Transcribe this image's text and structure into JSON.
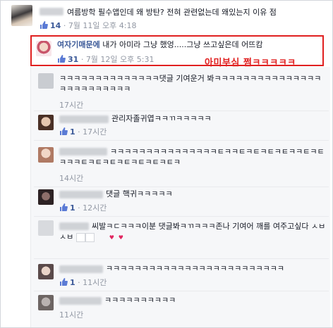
{
  "top_comment": {
    "text": "여름방학 필수앱인데 왜 방탄? 전혀 관련없는데 왜있는지 이유 점",
    "likes": "14",
    "time": "7월 11일 오후 4:18"
  },
  "highlighted_reply": {
    "name": "여자기매문에",
    "text": "내가 아미라 그냥 했엉.....그냥 쓰고싶은데 어뜨캄",
    "likes": "31",
    "time": "7월 12일 오후 5:31",
    "annotation": "아미부심 쩜ㅋㅋㅋㅋㅋ"
  },
  "replies": [
    {
      "text": "ㅋㅋㅋㅋㅋㅋㅋㅋㅋㅋㅋㅋㅋㅋ댓글 기여운거 봐ㅋㅋㅋㅋㅋㅋㅋㅋㅋㅋㅋㅋㅋㅋㅋㅋㅋㅋㅋㅋㅋㅋㅋㅋㅋ",
      "likes": "",
      "time": "17시간"
    },
    {
      "text": "관리자졸귀엽ㅋㅋㄲㅋㅋㅋㅋㅋ",
      "likes": "1",
      "time": "17시간"
    },
    {
      "text": "ㅋㅋㅋㅋㅋㅋㅋㅋㅋㅋㅋㅋㅋㅋㅋㅌㅋㅋㅌㅋㅌㅋㅌㅋㅌㅋㅋㅌㅋㅌㅋㅋㅋㅌㅋㅌㅋㅌㅋㅌㅋㅌㅋㅌㅋㅌㅋ",
      "likes": "",
      "time": "14시간"
    },
    {
      "text": "댓글 핵귀ㅋㅋㅋㅋㅋ",
      "likes": "1",
      "time": "12시간"
    },
    {
      "text": "씨발ㅋㄷㅋㅋㅋ이분 댓글봐ㅋㄲㅋㅋㅋ존나 기여어 깨를 여주고싶다 ㅅㅂㅅㅂ",
      "likes": "",
      "time": "12시간"
    },
    {
      "text": "ㅋㅋㅋㅋㅋㅋㅋㅋㅋㅋㅋㅋㅋㅋㅋㅋㅋㅋㅋㅋㅋㅋㅋㅋㅋ",
      "likes": "1",
      "time": "11시간"
    },
    {
      "text": "ㅋㅋㅋㅋㅋㅋㅋㅋㅋㅋ",
      "likes": "",
      "time": "11시간"
    }
  ],
  "colors": {
    "link": "#3b5998",
    "meta": "#9197a3",
    "highlight": "#e02020"
  }
}
